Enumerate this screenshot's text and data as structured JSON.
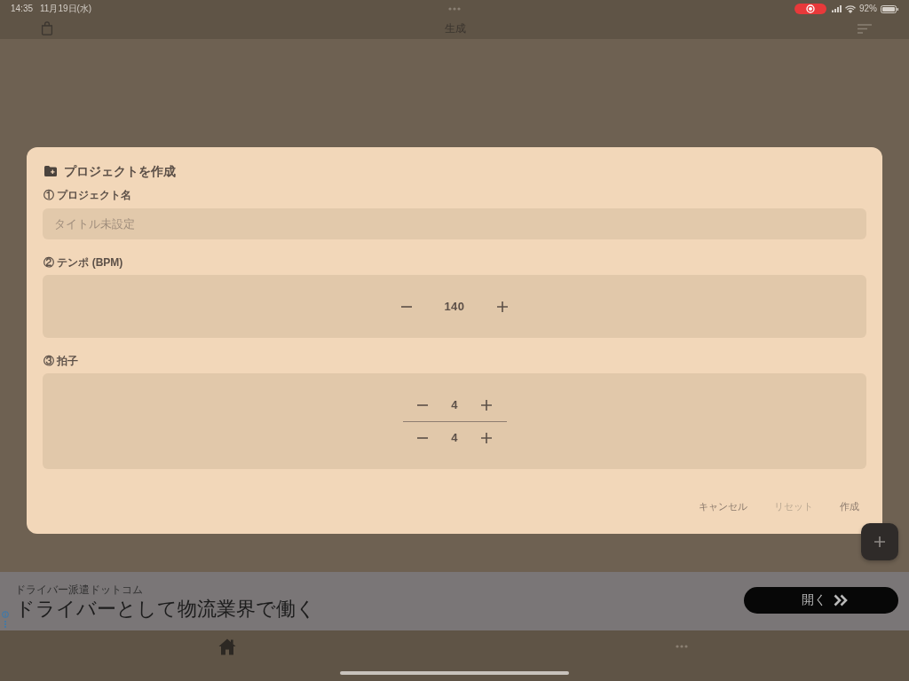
{
  "status_bar": {
    "time": "14:35",
    "date": "11月19日(水)",
    "battery": "92%"
  },
  "nav_bar": {
    "title": "生成"
  },
  "dialog": {
    "title": "プロジェクトを作成",
    "sections": [
      {
        "kind": "text",
        "label": "① プロジェクト名",
        "placeholder": "タイトル未設定"
      },
      {
        "kind": "stepper",
        "label": "② テンポ (BPM)",
        "values": [
          "140"
        ]
      },
      {
        "kind": "fraction",
        "label": "③ 拍子",
        "values": [
          "4",
          "4"
        ]
      }
    ],
    "buttons": [
      {
        "label": "キャンセル",
        "disabled": false
      },
      {
        "label": "リセット",
        "disabled": true
      },
      {
        "label": "作成",
        "disabled": false
      }
    ]
  },
  "ad": {
    "advertiser": "ドライバー派遣ドットコム",
    "headline": "ドライバーとして物流業界で働く",
    "button": "開く"
  },
  "tab_bar": {
    "tabs": [
      {
        "kind": "home",
        "selected": true
      },
      {
        "kind": "more",
        "selected": false
      }
    ]
  }
}
